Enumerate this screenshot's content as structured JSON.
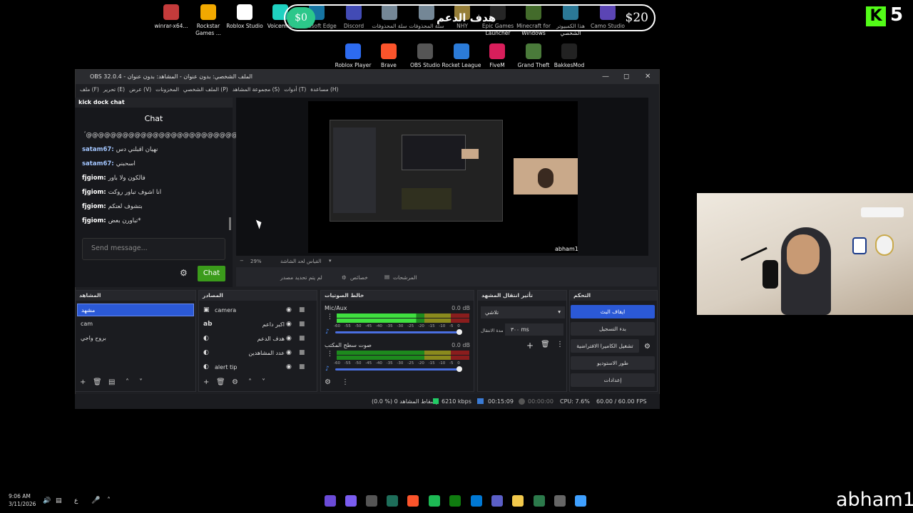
{
  "desktop": {
    "icons_row1": [
      {
        "label": "winrar-x64...",
        "color": "#c43b3b"
      },
      {
        "label": "Rockstar Games ...",
        "color": "#f2a900"
      },
      {
        "label": "Roblox Studio",
        "color": "#ffffff"
      },
      {
        "label": "Voicemod",
        "color": "#1fd1c1"
      },
      {
        "label": "Microsoft Edge",
        "color": "#1e9bd8"
      },
      {
        "label": "Discord",
        "color": "#5865f2"
      },
      {
        "label": "سلة المحذوفات",
        "color": "#9bb4c9"
      },
      {
        "label": "سلة المحذوفات",
        "color": "#9bb4c9"
      },
      {
        "label": "NHY",
        "color": "#c9a94b"
      },
      {
        "label": "Epic Games Launcher",
        "color": "#333333"
      },
      {
        "label": "Minecraft for Windows",
        "color": "#5a8f3a"
      },
      {
        "label": "هذا الكمبيوتر الشخصي",
        "color": "#3aa0c9"
      },
      {
        "label": "Camo Studio",
        "color": "#7a5cf0"
      }
    ],
    "icons_row2": [
      {
        "label": "Roblox Player",
        "color": "#2d6bf0"
      },
      {
        "label": "Brave",
        "color": "#fb542b"
      },
      {
        "label": "OBS Studio",
        "color": "#555555"
      },
      {
        "label": "Rocket League",
        "color": "#2b7bd8"
      },
      {
        "label": "FiveM",
        "color": "#d81e5b"
      },
      {
        "label": "Grand Theft Auto V",
        "color": "#4a7a3a"
      },
      {
        "label": "BakkesMod",
        "color": "#222222"
      }
    ]
  },
  "overlay": {
    "goal_left": "$0",
    "goal_label": "هدف الدعم",
    "goal_right": "$20",
    "kick_logo_letter": "K",
    "viewer_count": "5"
  },
  "obs": {
    "title": "OBS 32.0.4 - الملف الشخصي: بدون عنوان - المشاهد: بدون عنوان",
    "menu": [
      "ملف (F)",
      "تحرير (E)",
      "عرض (V)",
      "المخزونات",
      "الملف الشخصي (P)",
      "مجموعة المشاهد (S)",
      "أدوات (T)",
      "مساعدة (H)"
    ],
    "chat_dock": {
      "header": "kick dock chat",
      "title": "Chat",
      "messages": [
        {
          "user": "",
          "text": "ٴ@@@@@@@@@@@@@@@@@@@@@@@@@@@@@@@@@",
          "blue": false
        },
        {
          "user": "satam67:",
          "text": "نهيان اقبلني دس",
          "blue": true
        },
        {
          "user": "satam67:",
          "text": "اسحبني",
          "blue": true
        },
        {
          "user": "fjgiom:",
          "text": "فالكون ولا باور",
          "blue": false
        },
        {
          "user": "fjgiom:",
          "text": "انا اشوف تباور روكت",
          "blue": false
        },
        {
          "user": "fjgiom:",
          "text": "بتشوف لعتكم",
          "blue": false
        },
        {
          "user": "fjgiom:",
          "text": "تباورن بعض*",
          "blue": false
        }
      ],
      "send_placeholder": "Send message...",
      "send_button": "Chat"
    },
    "preview": {
      "streamer_name": "abham1",
      "zoom": "29%",
      "zoom_label": "القياس لحد الشاشة",
      "no_source": "لم يتم تحديد مصدر",
      "properties": "خصائص",
      "filters": "المرشحات"
    },
    "scenes": {
      "header": "المشاهد",
      "items": [
        "مشهد",
        "cam",
        "بروح واجي"
      ],
      "selected": 0
    },
    "sources": {
      "header": "المصادر",
      "items": [
        {
          "name": "camera",
          "icon": "camera-icon"
        },
        {
          "name": "اكبر داعم",
          "icon": "text-icon"
        },
        {
          "name": "هدف الدعم",
          "icon": "browser-icon"
        },
        {
          "name": "عدد المشاهدين",
          "icon": "browser-icon"
        },
        {
          "name": "alert tip",
          "icon": "browser-icon"
        }
      ]
    },
    "mixer": {
      "header": "خالط الصوتيات",
      "channels": [
        {
          "name": "Mic/Aux",
          "db": "0.0 dB",
          "lit": 0.6
        },
        {
          "name": "صوت سطح المكتب",
          "db": "0.0 dB",
          "lit": 0.0
        }
      ],
      "scale": "-60 -55 -50 -45 -40 -35 -30 -25 -20 -15 -10 -5 0"
    },
    "transitions": {
      "header": "تأثير انتقال المشهد",
      "type": "تلاشي",
      "duration_label": "مدة الانتقال",
      "duration": "٣٠٠ ms"
    },
    "controls": {
      "header": "التحكم",
      "buttons": [
        "ايقاف البث",
        "بدء التسجيل",
        "تشغيل الكاميرا الافتراضية",
        "طور الاستوديو",
        "إعدادات"
      ]
    },
    "status": {
      "dropped": "(0.0 %) 0 إسقاط المشاهد",
      "bitrate": "6210 kbps",
      "live_time": "00:15:09",
      "rec_time": "00:00:00",
      "cpu": "CPU: 7.6%",
      "fps": "60.00 / 60.00 FPS"
    }
  },
  "taskbar": {
    "time": "9:06 AM",
    "date": "3/11/2026",
    "lang": "ع",
    "streamer_name": "abham1"
  }
}
